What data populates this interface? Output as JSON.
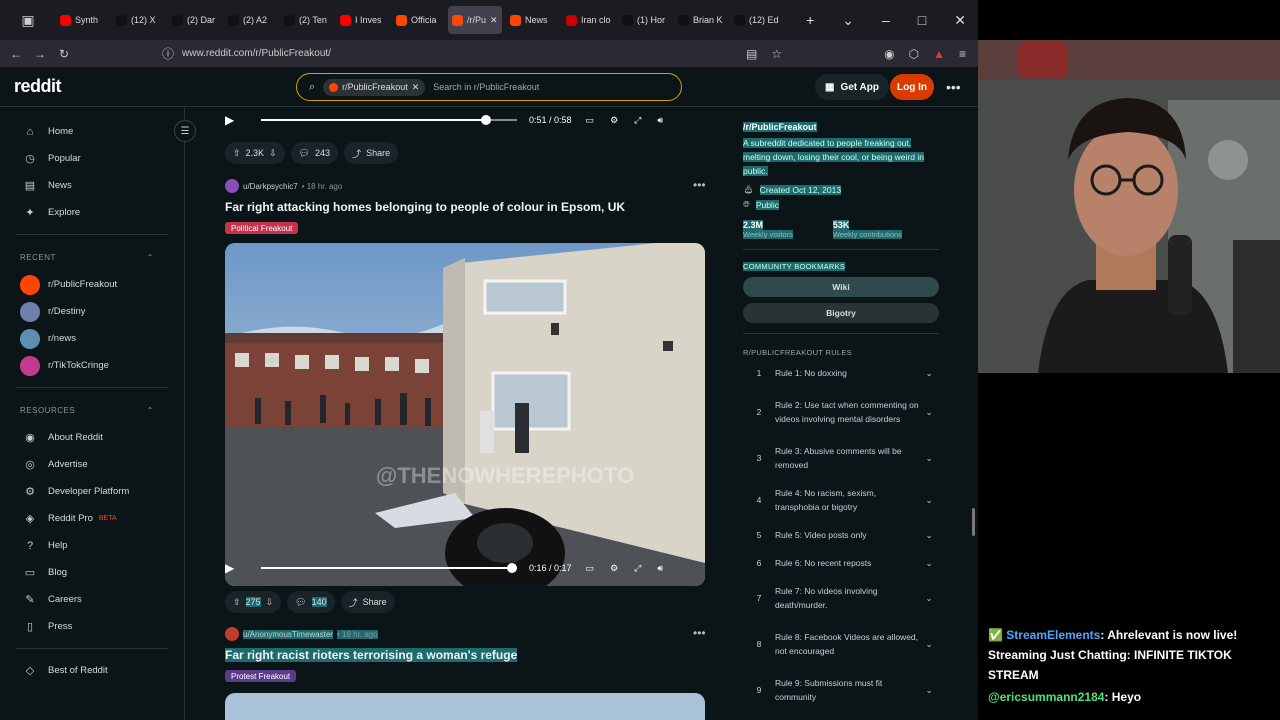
{
  "browser": {
    "tabs": [
      {
        "label": "Synth",
        "color": "#ff0000"
      },
      {
        "label": "(12) X",
        "color": "#111111"
      },
      {
        "label": "(2) Dar",
        "color": "#111111"
      },
      {
        "label": "(2) A2",
        "color": "#111111"
      },
      {
        "label": "(2) Ten",
        "color": "#111111"
      },
      {
        "label": "I Inves",
        "color": "#ff0000"
      },
      {
        "label": "Officia",
        "color": "#ff4500"
      },
      {
        "label": "/r/Pu",
        "color": "#ff4500"
      },
      {
        "label": "News",
        "color": "#ff4500"
      },
      {
        "label": "Iran clo",
        "color": "#cc0000"
      },
      {
        "label": "(1) Hor",
        "color": "#111111"
      },
      {
        "label": "Brian K",
        "color": "#111111"
      },
      {
        "label": "(12) Ed",
        "color": "#111111"
      }
    ],
    "url": "www.reddit.com/r/PublicFreakout/"
  },
  "header": {
    "logo": "reddit",
    "search_chip": "r/PublicFreakout",
    "search_placeholder": "Search in r/PublicFreakout",
    "get_app": "Get App",
    "login": "Log In"
  },
  "leftnav": {
    "main": [
      {
        "label": "Home",
        "icon": "home-icon"
      },
      {
        "label": "Popular",
        "icon": "popular-icon"
      },
      {
        "label": "News",
        "icon": "news-icon"
      },
      {
        "label": "Explore",
        "icon": "explore-icon"
      }
    ],
    "recent_heading": "RECENT",
    "recent": [
      {
        "label": "r/PublicFreakout",
        "color": "#ff4500"
      },
      {
        "label": "r/Destiny",
        "color": "#6f7fae"
      },
      {
        "label": "r/news",
        "color": "#5d8fb0"
      },
      {
        "label": "r/TikTokCringe",
        "color": "#c33b8e"
      }
    ],
    "resources_heading": "RESOURCES",
    "resources": [
      {
        "label": "About Reddit",
        "icon": "reddit-icon"
      },
      {
        "label": "Advertise",
        "icon": "advertise-icon"
      },
      {
        "label": "Developer Platform",
        "icon": "developer-icon"
      },
      {
        "label": "Reddit Pro",
        "icon": "pro-icon",
        "badge": "BETA"
      },
      {
        "label": "Help",
        "icon": "help-icon"
      },
      {
        "label": "Blog",
        "icon": "blog-icon"
      },
      {
        "label": "Careers",
        "icon": "careers-icon"
      },
      {
        "label": "Press",
        "icon": "press-icon"
      }
    ],
    "best_of": "Best of Reddit"
  },
  "feed": {
    "player1": {
      "time": "0:51 / 0:58",
      "progress": 0.88
    },
    "post0_actions": {
      "votes": "2.3K",
      "comments": "243",
      "share": "Share"
    },
    "post1": {
      "user": "u/Darkpsychic7",
      "age": "• 18 hr. ago",
      "title": "Far right attacking homes belonging to people of colour in Epsom, UK",
      "flair": "Political Freakout",
      "watermark": "@THENOWHEREPHOTO",
      "time": "0:16 / 0:17",
      "progress": 0.98,
      "votes": "275",
      "comments": "140",
      "share": "Share"
    },
    "post2": {
      "user": "u/AnonymousTimewaster",
      "age": "• 18 hr. ago",
      "title": "Far right racist rioters terrorising a woman's refuge",
      "flair": "Protest Freakout"
    }
  },
  "sidebar": {
    "title": "/r/PublicFreakout",
    "description": "A subreddit dedicated to people freaking out, melting down, losing their cool, or being weird in public.",
    "created": "Created Oct 12, 2013",
    "visibility": "Public",
    "stats": [
      {
        "value": "2.3M",
        "label": "Weekly visitors"
      },
      {
        "value": "53K",
        "label": "Weekly contributions"
      }
    ],
    "bookmarks_heading": "COMMUNITY BOOKMARKS",
    "bookmarks": [
      "Wiki",
      "Bigotry"
    ],
    "rules_heading": "R/PUBLICFREAKOUT RULES",
    "rules": [
      {
        "num": "1",
        "text": "Rule 1: No doxxing"
      },
      {
        "num": "2",
        "text": "Rule 2: Use tact when commenting on videos involving mental disorders"
      },
      {
        "num": "3",
        "text": "Rule 3: Abusive comments will be removed"
      },
      {
        "num": "4",
        "text": "Rule 4: No racism, sexism, transphobia or bigotry"
      },
      {
        "num": "5",
        "text": "Rule 5: Video posts only"
      },
      {
        "num": "6",
        "text": "Rule 6: No recent reposts"
      },
      {
        "num": "7",
        "text": "Rule 7: No videos involving death/murder."
      },
      {
        "num": "8",
        "text": "Rule 8: Facebook Videos are allowed, not encouraged"
      },
      {
        "num": "9",
        "text": "Rule 9: Submissions must fit community"
      }
    ]
  },
  "chat": {
    "line1_user": "StreamElements",
    "line1_text": ": Ahrelevant is now live! Streaming Just Chatting: INFINITE TIKTOK STREAM",
    "line2_user": "@ericsummann2184",
    "line2_text": ": Heyo"
  }
}
